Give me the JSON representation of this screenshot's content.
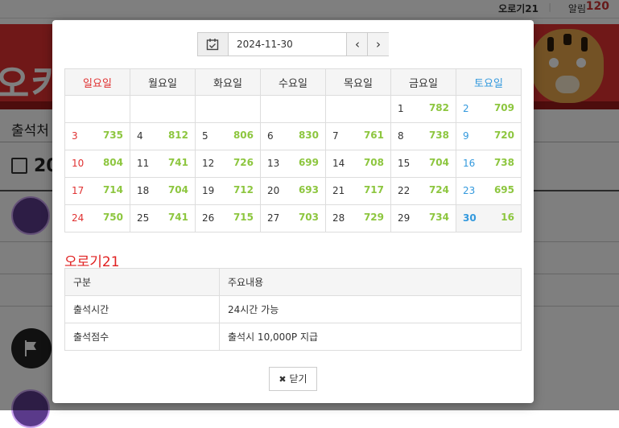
{
  "header": {
    "username": "오로기21",
    "alarm_label": "알림",
    "alarm_count": "120"
  },
  "page": {
    "title_fragment": "출석처",
    "year_fragment": "20"
  },
  "modal": {
    "selected_date": "2024-11-30",
    "weekdays": [
      "일요일",
      "월요일",
      "화요일",
      "수요일",
      "목요일",
      "금요일",
      "토요일"
    ],
    "weeks": [
      [
        {
          "day": "",
          "points": ""
        },
        {
          "day": "",
          "points": ""
        },
        {
          "day": "",
          "points": ""
        },
        {
          "day": "",
          "points": ""
        },
        {
          "day": "",
          "points": ""
        },
        {
          "day": "1",
          "points": "782"
        },
        {
          "day": "2",
          "points": "709"
        }
      ],
      [
        {
          "day": "3",
          "points": "735"
        },
        {
          "day": "4",
          "points": "812"
        },
        {
          "day": "5",
          "points": "806"
        },
        {
          "day": "6",
          "points": "830"
        },
        {
          "day": "7",
          "points": "761"
        },
        {
          "day": "8",
          "points": "738"
        },
        {
          "day": "9",
          "points": "720"
        }
      ],
      [
        {
          "day": "10",
          "points": "804"
        },
        {
          "day": "11",
          "points": "741"
        },
        {
          "day": "12",
          "points": "726"
        },
        {
          "day": "13",
          "points": "699"
        },
        {
          "day": "14",
          "points": "708"
        },
        {
          "day": "15",
          "points": "704"
        },
        {
          "day": "16",
          "points": "738"
        }
      ],
      [
        {
          "day": "17",
          "points": "714"
        },
        {
          "day": "18",
          "points": "704"
        },
        {
          "day": "19",
          "points": "712"
        },
        {
          "day": "20",
          "points": "693"
        },
        {
          "day": "21",
          "points": "717"
        },
        {
          "day": "22",
          "points": "724"
        },
        {
          "day": "23",
          "points": "695"
        }
      ],
      [
        {
          "day": "24",
          "points": "750"
        },
        {
          "day": "25",
          "points": "741"
        },
        {
          "day": "26",
          "points": "715"
        },
        {
          "day": "27",
          "points": "703"
        },
        {
          "day": "28",
          "points": "729"
        },
        {
          "day": "29",
          "points": "734"
        },
        {
          "day": "30",
          "points": "16"
        }
      ]
    ],
    "info_title": "오로기21",
    "info_table": {
      "headers": [
        "구분",
        "주요내용"
      ],
      "rows": [
        [
          "출석시간",
          "24시간 가능"
        ],
        [
          "출석점수",
          "출석시 10,000P 지급"
        ]
      ]
    },
    "close_label": "닫기"
  },
  "colors": {
    "sunday": "#e03131",
    "saturday": "#3399dd",
    "points": "#8dc63f",
    "info_title": "#e02020"
  }
}
